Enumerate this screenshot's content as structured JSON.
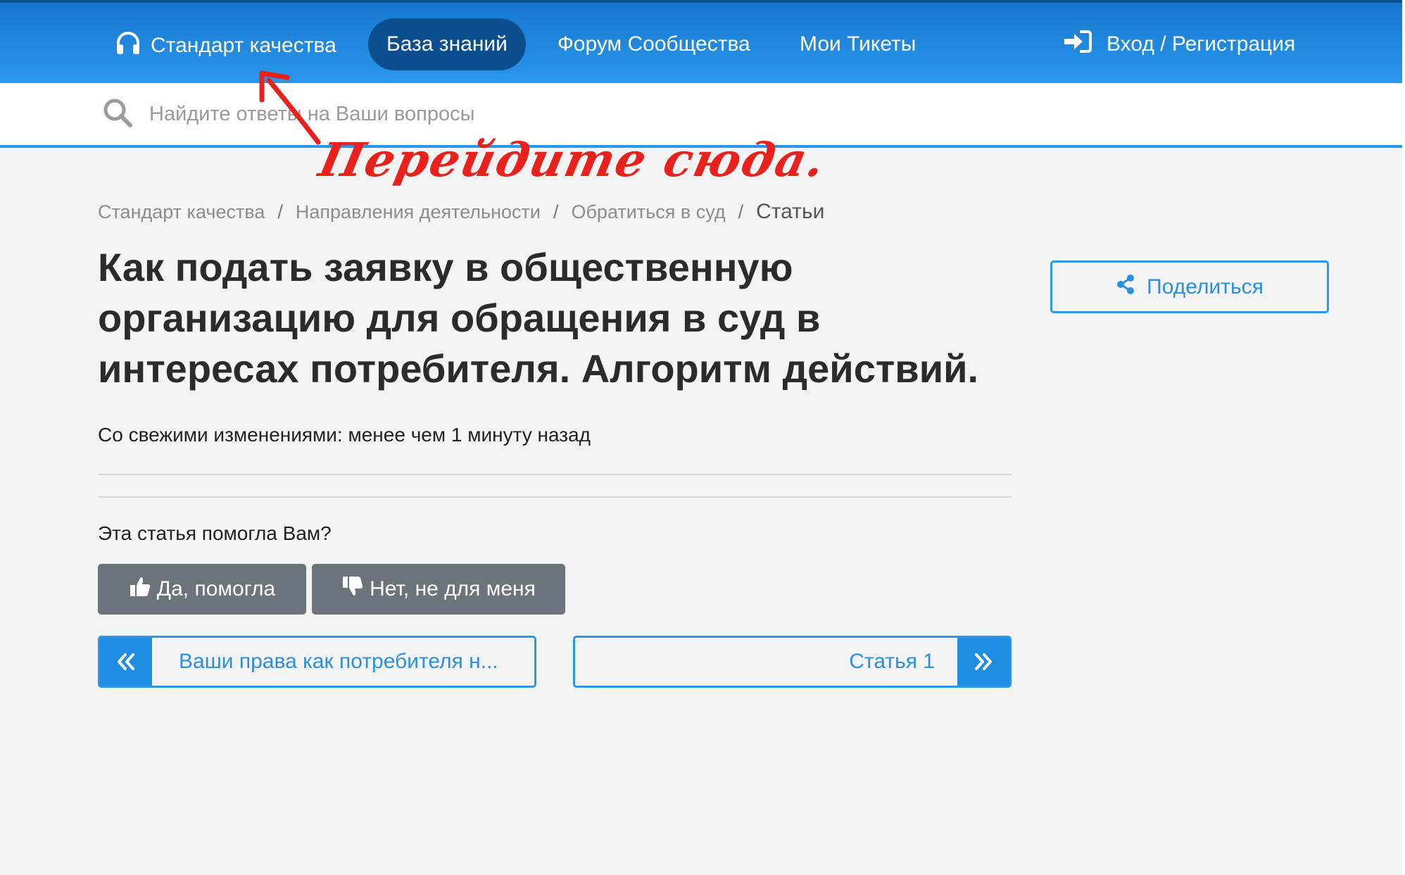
{
  "header": {
    "brand_label": "Стандарт качества",
    "nav": [
      "База знаний",
      "Форум Сообщества",
      "Мои Тикеты"
    ],
    "login_label": "Вход / Регистрация"
  },
  "search": {
    "placeholder": "Найдите ответы на Ваши вопросы"
  },
  "annotation": {
    "text": "Перейдите сюда."
  },
  "breadcrumb": [
    "Стандарт качества",
    "Направления деятельности",
    "Обратиться в суд",
    "Статьи"
  ],
  "article": {
    "title": "Как подать заявку в общественную организацию для обращения в суд в интересах потребителя. Алгоритм действий.",
    "updated": "Со свежими изменениями: менее чем 1 минуту назад"
  },
  "feedback": {
    "question": "Эта статья помогла Вам?",
    "yes_label": "Да, помогла",
    "no_label": "Нет, не для меня"
  },
  "pager": {
    "prev_label": "Ваши права как потребителя н...",
    "next_label": "Статья 1"
  },
  "share_label": "Поделиться",
  "colors": {
    "header_blue": "#2a97ea",
    "active_nav": "#0b4f8f",
    "vote_button": "#6c737b",
    "annotation_red": "#e8211c"
  }
}
